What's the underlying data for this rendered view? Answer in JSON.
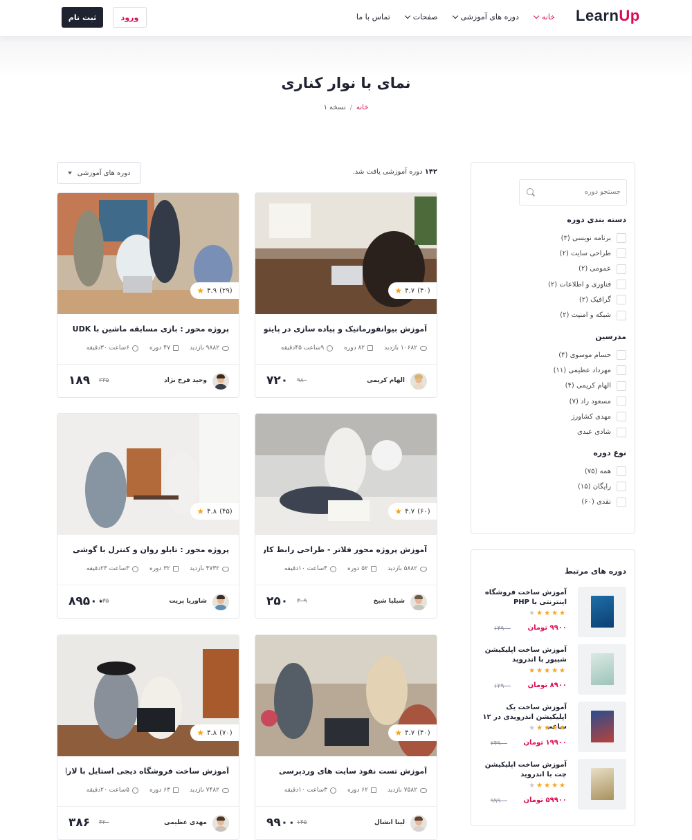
{
  "header": {
    "logo_part1": "Learn",
    "logo_part2": "Up",
    "nav": [
      {
        "label": "خانه",
        "dropdown": true,
        "active": true
      },
      {
        "label": "دوره های آموزشی",
        "dropdown": true
      },
      {
        "label": "صفحات",
        "dropdown": true
      },
      {
        "label": "تماس با ما",
        "dropdown": false
      }
    ],
    "login_label": "ورود",
    "signup_label": "ثبت نام"
  },
  "page": {
    "title": "نمای با نوار کناری",
    "breadcrumb_home": "خانه",
    "breadcrumb_sep": "/",
    "breadcrumb_current": "نسخه ۱"
  },
  "results": {
    "count": "۱۴۲",
    "text": "دوره آموزشی یافت شد.",
    "sort_label": "دوره های آموزشی"
  },
  "sidebar": {
    "search_placeholder": "جستجو دوره",
    "categories_title": "دسته بندی دوره",
    "categories": [
      "برنامه نویسی (۳)",
      "طراحی سایت (۲)",
      "عمومی (۲)",
      "فناوری و اطلاعات (۲)",
      "گرافیک (۲)",
      "شبکه و امنیت (۲)"
    ],
    "teachers_title": "مدرسین",
    "teachers": [
      "حسام موسوی (۴)",
      "مهرداد عظیمی (۱۱)",
      "الهام کریمی (۴)",
      "مسعود راد (۷)",
      "مهدی کشاورز",
      "شادی عبدی"
    ],
    "types_title": "نوع دوره",
    "types": [
      "همه (۷۵)",
      "رایگان (۱۵)",
      "نقدی (۶۰)"
    ]
  },
  "related": {
    "title": "دوره های مرتبط",
    "items": [
      {
        "title": "آموزش ساخت فروشگاه اینترنتی با PHP",
        "stars": 4,
        "price": "۹۹۰۰ تومان",
        "old": "۱۴۹۰۰"
      },
      {
        "title": "آموزش ساخت اپلیکیشن شیپور با اندروید",
        "stars": 5,
        "price": "۸۹۰۰ تومان",
        "old": "۱۲۹۰۰"
      },
      {
        "title": "آموزش ساخت یک اپلیکیشن اندرویدی در ۱۲ ساعت",
        "stars": 4,
        "price": "۱۹۹۰۰ تومان",
        "old": "۲۴۹۰۰"
      },
      {
        "title": "آموزش ساخت اپلیکیشن چت با اندروید",
        "stars": 4,
        "price": "۵۹۹۰۰ تومان",
        "old": "۹۹۹۰۰"
      }
    ]
  },
  "courses": [
    {
      "title": "آموزش بیوانفورماتیک و پیاده سازی در پایتون",
      "rating": "۴.۷",
      "reviews": "(۴۰)",
      "views": "۱۰۶۸۲ بازدید",
      "lessons": "۸۲ دوره",
      "duration": "۹ساعت ۴۵دقیقه",
      "teacher": "الهام کریمی",
      "price": "۷۲۰",
      "old_price": "۹۸۰"
    },
    {
      "title": "پروژه محور : بازی مسابقه ماشین با UDK",
      "rating": "۴.۹",
      "reviews": "(۲۹)",
      "views": "۹۸۸۲ بازدید",
      "lessons": "۴۷ دوره",
      "duration": "۶ساعت ۳۰دقیقه",
      "teacher": "وحید فرخ نژاد",
      "price": "۱۸۹",
      "old_price": "۲۳۵"
    },
    {
      "title": "آموزش پروژه محور فلاتر - طراحی رابط کاربری UI",
      "rating": "۴.۷",
      "reviews": "(۶۰)",
      "views": "۵۸۸۲ بازدید",
      "lessons": "۵۲ دوره",
      "duration": "۴ساعت ۱۰دقیقه",
      "teacher": "شیلیا شیخ",
      "price": "۲۵۰",
      "old_price": "۳۰۹"
    },
    {
      "title": "پروژه محور : تابلو روان و کنترل با گوشی",
      "rating": "۴.۸",
      "reviews": "(۴۵)",
      "views": "۴۷۳۲ بازدید",
      "lessons": "۳۲ دوره",
      "duration": "۳ساعت ۲۳دقیقه",
      "teacher": "شاوریا پریت",
      "price": "۸۹۵۰۰",
      "old_price": "۱۳۵"
    },
    {
      "title": "آموزش تست نفوذ سایت های وردپرسی",
      "rating": "۴.۷",
      "reviews": "(۴۰)",
      "views": "۷۵۸۲ بازدید",
      "lessons": "۶۲ دوره",
      "duration": "۳ساعت ۱۰دقیقه",
      "teacher": "لیتا انشال",
      "price": "۹۹۰۰",
      "old_price": "۱۴۵"
    },
    {
      "title": "آموزش ساخت فروشگاه دیجی استایل با لاراول",
      "rating": "۴.۸",
      "reviews": "(۷۰)",
      "views": "۷۴۸۲ بازدید",
      "lessons": "۶۳ دوره",
      "duration": "۵ساعت ۲۰دقیقه",
      "teacher": "مهدی عظیمی",
      "price": "۳۸۶",
      "old_price": "۴۲۰"
    }
  ],
  "colors": {
    "accent": "#da0b4e",
    "dark": "#1f2230",
    "star": "#f7a31a"
  }
}
